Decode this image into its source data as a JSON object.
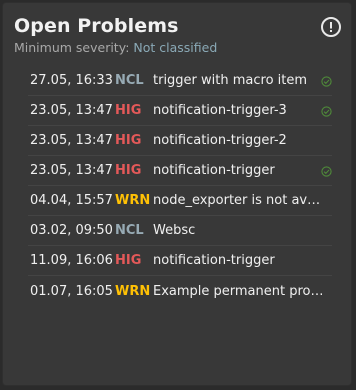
{
  "widget": {
    "title": "Open Problems",
    "subtitle_prefix": "Minimum severity: ",
    "subtitle_value": "Not classified"
  },
  "colors": {
    "ncl": "#97aab4",
    "hig": "#e45959",
    "wrn": "#ffc105",
    "ack": "#4f8a3a"
  },
  "problems": [
    {
      "time": "27.05, 16:33",
      "severity": "NCL",
      "description": "trigger with macro item",
      "acknowledged": true
    },
    {
      "time": "23.05, 13:47",
      "severity": "HIG",
      "description": "notification-trigger-3",
      "acknowledged": true
    },
    {
      "time": "23.05, 13:47",
      "severity": "HIG",
      "description": "notification-trigger-2",
      "acknowledged": false
    },
    {
      "time": "23.05, 13:47",
      "severity": "HIG",
      "description": "notification-trigger",
      "acknowledged": true
    },
    {
      "time": "04.04, 15:57",
      "severity": "WRN",
      "description": "node_exporter is not available",
      "acknowledged": false
    },
    {
      "time": "03.02, 09:50",
      "severity": "NCL",
      "description": "Websc",
      "acknowledged": false
    },
    {
      "time": "11.09, 16:06",
      "severity": "HIG",
      "description": "notification-trigger",
      "acknowledged": false
    },
    {
      "time": "01.07, 16:05",
      "severity": "WRN",
      "description": "Example permanent problem",
      "acknowledged": false
    }
  ]
}
